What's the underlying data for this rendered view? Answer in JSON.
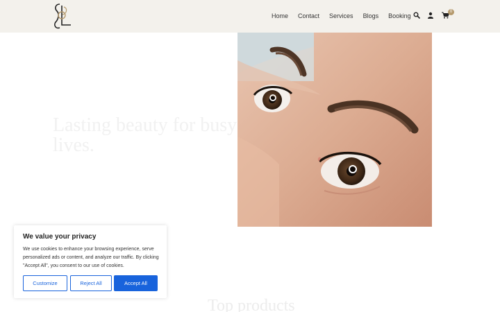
{
  "header": {
    "nav": [
      "Home",
      "Contact",
      "Services",
      "Blogs",
      "Booking"
    ],
    "cart_count": "0",
    "icons": [
      "search-icon",
      "user-icon",
      "cart-icon"
    ],
    "background": "#f3f1ec",
    "accent": "#b59a6d"
  },
  "hero": {
    "title": "Lasting beauty for busy lives."
  },
  "products": {
    "title": "Top products"
  },
  "cookie_banner": {
    "title": "We value your privacy",
    "text": "We use cookies to enhance your browsing experience, serve personalized ads or content, and analyze our traffic. By clicking \"Accept All\", you consent to our use of cookies.",
    "customize": "Customize",
    "reject": "Reject All",
    "accept": "Accept All",
    "button_color": "#1863dc"
  }
}
